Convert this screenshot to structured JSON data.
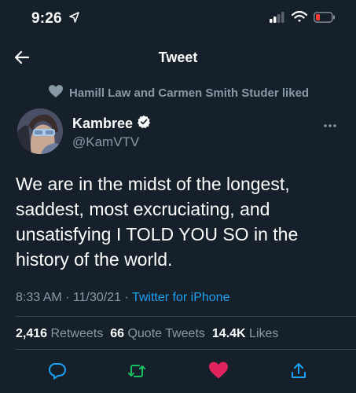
{
  "status_bar": {
    "time": "9:26"
  },
  "nav": {
    "title": "Tweet"
  },
  "social_context": {
    "text": "Hamill Law and Carmen Smith Studer liked"
  },
  "author": {
    "name": "Kambree",
    "handle": "@KamVTV"
  },
  "tweet": {
    "text": "We are in the midst of the longest, saddest, most excruciating, and unsatisfying I TOLD YOU SO in the history of the world.",
    "time": "8:33 AM",
    "date": "11/30/21",
    "source": "Twitter for iPhone"
  },
  "stats": {
    "retweets_count": "2,416",
    "retweets_label": "Retweets",
    "quotes_count": "66",
    "quotes_label": "Quote Tweets",
    "likes_count": "14.4K",
    "likes_label": "Likes"
  },
  "colors": {
    "background": "#15202b",
    "secondary_text": "#8899a6",
    "accent": "#1da1f2",
    "retweet": "#17bf63",
    "like": "#e0245e",
    "divider": "#38444d"
  },
  "icons": {
    "back": "arrow-left-icon",
    "liked_context": "heart-icon",
    "verified": "verified-badge-icon",
    "more": "more-horizontal-icon",
    "reply": "reply-icon",
    "retweet": "retweet-icon",
    "like": "heart-filled-icon",
    "share": "share-icon"
  },
  "actions": {
    "liked": true,
    "retweeted": true
  }
}
